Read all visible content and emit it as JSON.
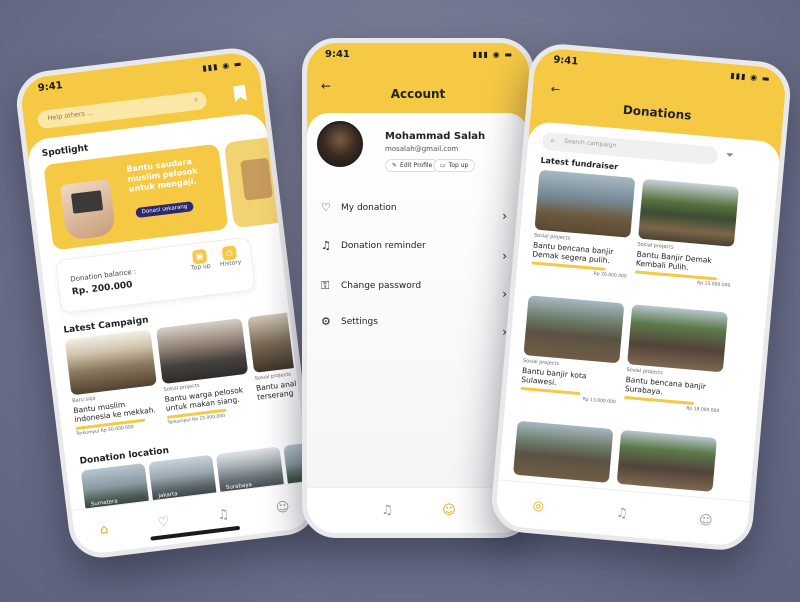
{
  "status": {
    "time": "9:41",
    "icons": "▮▮▮ ◉ ▬"
  },
  "colors": {
    "accent": "#f6c945",
    "accent_dark": "#e3aa1c",
    "background": "#6c708a"
  },
  "phone1": {
    "search": {
      "placeholder": "Help others ..."
    },
    "spotlight": {
      "title": "Spotlight",
      "banner_text": "Bantu saudara muslim pelosok untuk mengaji.",
      "banner_button": "Donasi sekarang"
    },
    "balance": {
      "label": "Donation balance :",
      "value": "Rp. 200.000",
      "topup": "Top up",
      "history": "History"
    },
    "latest_campaign": {
      "title": "Latest Campaign",
      "items": [
        {
          "tag": "Baru saja",
          "title": "Bantu muslim indonesia ke mekkah.",
          "meta": "Terkumpul  Rp 50.000.000"
        },
        {
          "tag": "Sosial projects",
          "title": "Bantu warga pelosok untuk makan siang.",
          "meta": "Terkumpul  Rp 25.000.000"
        },
        {
          "tag": "Sosial projects",
          "title": "Bantu anak terserang",
          "meta": ""
        }
      ]
    },
    "donation_location": {
      "title": "Donation location",
      "items": [
        "Sumatera",
        "Jakarta",
        "Surabaya",
        ""
      ]
    }
  },
  "phone2": {
    "title": "Account",
    "back_icon": "←",
    "user": {
      "name": "Mohammad Salah",
      "email": "mosalah@gmail.com"
    },
    "buttons": {
      "edit": "Edit Profile",
      "topup": "Top up"
    },
    "menu": [
      {
        "icon": "heart-icon",
        "label": "My donation"
      },
      {
        "icon": "bell-icon",
        "label": "Donation reminder"
      },
      {
        "icon": "lock-icon",
        "label": "Change password"
      },
      {
        "icon": "settings-icon",
        "label": "Settings"
      }
    ]
  },
  "phone3": {
    "title": "Donations",
    "search": {
      "placeholder": "Search campaign"
    },
    "subtitle": "Latest fundraiser",
    "items": [
      {
        "tag": "Sosial projects",
        "title": "Bantu bencana banjir Demak segera pulih.",
        "meta": "Rp 20.000.000"
      },
      {
        "tag": "Sosial projects",
        "title": "Bantu Banjir Demak Kembali Pulih.",
        "meta": "Rp 15.000.000"
      },
      {
        "tag": "Sosial projects",
        "title": "Bantu banjir kota Sulawesi.",
        "meta": "Rp 13.000.000"
      },
      {
        "tag": "Sosial projects",
        "title": "Bantu bencana banjir Surabaya.",
        "meta": "Rp 18.000.000"
      }
    ]
  }
}
